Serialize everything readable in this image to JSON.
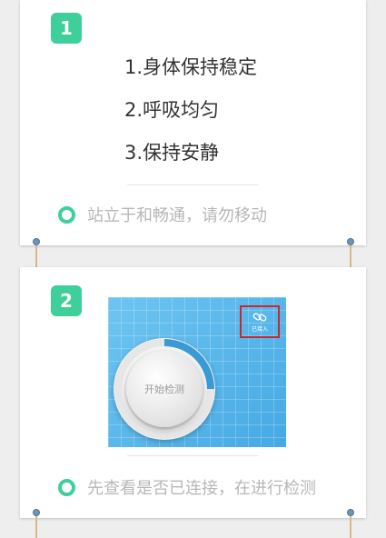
{
  "card1": {
    "badge": "1",
    "steps": [
      "1.身体保持稳定",
      "2.呼吸均匀",
      "3.保持安静"
    ],
    "tip": "站立于和畅通，请勿移动"
  },
  "card2": {
    "badge": "2",
    "panel": {
      "start_button": "开始检测",
      "connect_status": "已接入",
      "connect_icon": "link-icon"
    },
    "tip": "先查看是否已连接，在进行检测"
  },
  "colors": {
    "accent": "#3fcf9a",
    "panel_blue": "#46a9e4",
    "highlight_red": "#c8282e"
  }
}
